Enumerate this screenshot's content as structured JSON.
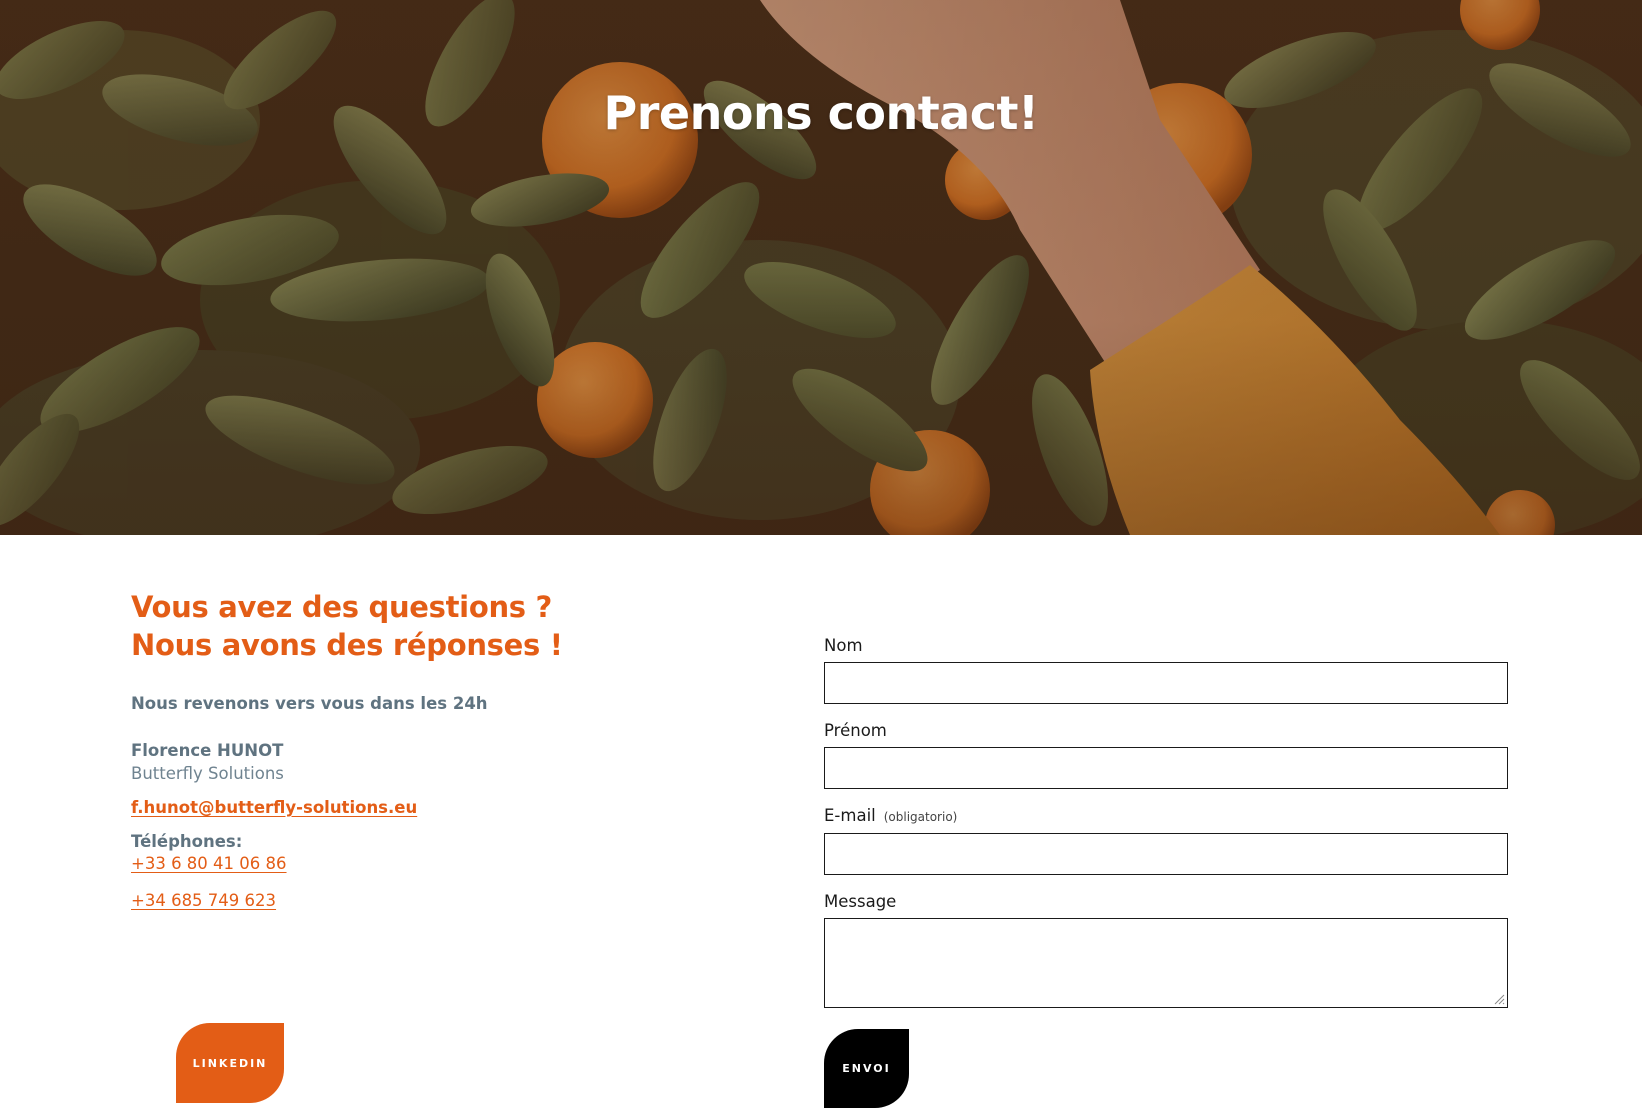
{
  "hero": {
    "title": "Prenons contact!"
  },
  "contact_info": {
    "headline_line1": "Vous avez des questions ?",
    "headline_line2": "Nous avons des réponses !",
    "response_time": "Nous revenons vers vous dans les 24h",
    "person_name": "Florence HUNOT",
    "company": "Butterfly Solutions",
    "email": "f.hunot@butterfly-solutions.eu",
    "phones_label": "Téléphones:",
    "phone_1": "+33 6 80 41 06 86",
    "phone_2": "+34 685 749 623",
    "linkedin_label": "LINKEDIN"
  },
  "form": {
    "nom_label": "Nom",
    "nom_value": "",
    "prenom_label": "Prénom",
    "prenom_value": "",
    "email_label": "E-mail",
    "email_note": "(obligatorio)",
    "email_value": "",
    "message_label": "Message",
    "message_value": "",
    "submit_label": "ENVOI"
  },
  "colors": {
    "accent": "#e35d16",
    "muted_text": "#5f7380",
    "submit_bg": "#000000"
  },
  "icons": {
    "resize_grip": "resize-grip-icon"
  }
}
